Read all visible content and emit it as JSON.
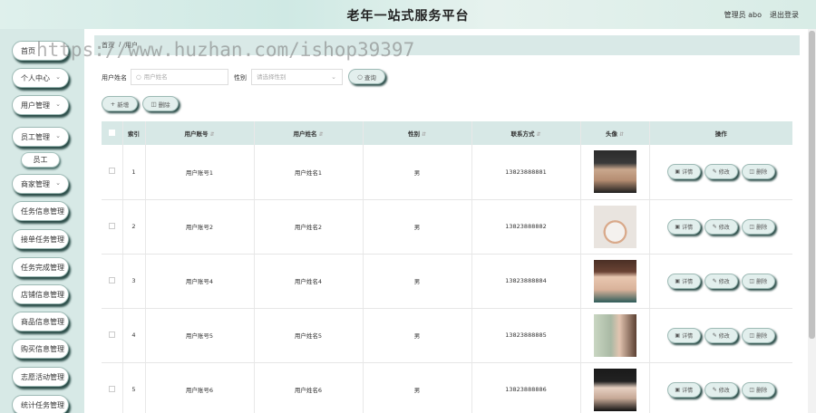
{
  "header": {
    "title": "老年一站式服务平台",
    "admin_label": "管理员 abo",
    "logout_label": "退出登录"
  },
  "watermark": "https://www.huzhan.com/ishop39397",
  "breadcrumb": {
    "home": "首页",
    "separator": "/",
    "current": "用户"
  },
  "sidebar": {
    "items": [
      {
        "label": "首页",
        "arrow": false
      },
      {
        "label": "个人中心",
        "arrow": true
      },
      {
        "label": "用户管理",
        "arrow": true
      },
      {
        "label": "员工管理",
        "arrow": true
      },
      {
        "label": "员工",
        "sub": true
      },
      {
        "label": "商家管理",
        "arrow": true
      },
      {
        "label": "任务信息管理",
        "arrow": false
      },
      {
        "label": "接单任务管理",
        "arrow": false
      },
      {
        "label": "任务完成管理",
        "arrow": false
      },
      {
        "label": "店铺信息管理",
        "arrow": false
      },
      {
        "label": "商品信息管理",
        "arrow": false
      },
      {
        "label": "购买信息管理",
        "arrow": false
      },
      {
        "label": "志愿活动管理",
        "arrow": false
      },
      {
        "label": "统计任务管理",
        "arrow": false
      }
    ]
  },
  "search": {
    "name_label": "用户姓名",
    "name_placeholder": "用户姓名",
    "gender_label": "性别",
    "gender_placeholder": "请选择性别",
    "query_label": "查询"
  },
  "toolbar": {
    "add_label": "新增",
    "delete_label": "删除"
  },
  "table": {
    "columns": [
      "索引",
      "用户账号",
      "用户姓名",
      "性别",
      "联系方式",
      "头像",
      "操作"
    ],
    "actions": {
      "detail": "详情",
      "edit": "修改",
      "delete": "删除"
    },
    "rows": [
      {
        "index": "1",
        "account": "用户账号1",
        "name": "用户姓名1",
        "gender": "男",
        "phone": "13823888881"
      },
      {
        "index": "2",
        "account": "用户账号2",
        "name": "用户姓名2",
        "gender": "男",
        "phone": "13823888882"
      },
      {
        "index": "3",
        "account": "用户账号4",
        "name": "用户姓名4",
        "gender": "男",
        "phone": "13823888884"
      },
      {
        "index": "4",
        "account": "用户账号5",
        "name": "用户姓名5",
        "gender": "男",
        "phone": "13823888885"
      },
      {
        "index": "5",
        "account": "用户账号6",
        "name": "用户姓名6",
        "gender": "男",
        "phone": "13823888886"
      }
    ]
  }
}
